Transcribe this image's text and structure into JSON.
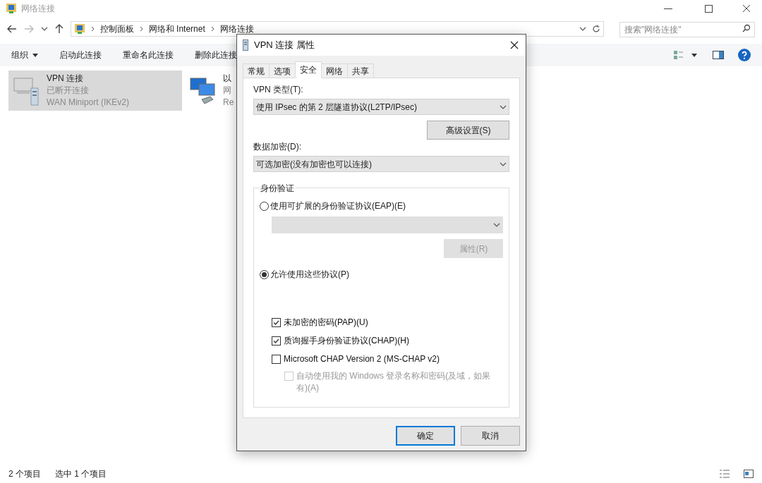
{
  "window": {
    "title": "网络连接"
  },
  "breadcrumbs": [
    "控制面板",
    "网络和 Internet",
    "网络连接"
  ],
  "search": {
    "placeholder": "搜索\"网络连接\""
  },
  "toolbar": [
    {
      "label": "组织",
      "kind": "menu"
    },
    {
      "label": "启动此连接",
      "kind": "action"
    },
    {
      "label": "重命名此连接",
      "kind": "action"
    },
    {
      "label": "删除此连接",
      "kind": "action"
    }
  ],
  "connections": [
    {
      "name": "VPN 连接",
      "status": "已断开连接",
      "device": "WAN Miniport (IKEv2)",
      "selected": true,
      "kind": "vpn"
    },
    {
      "name": "以",
      "status": "网",
      "device": "Re",
      "selected": false,
      "kind": "ethernet"
    }
  ],
  "status_bar": {
    "count": "2 个项目",
    "selection": "选中 1 个项目"
  },
  "dialog": {
    "title": "VPN 连接 属性",
    "tabs": [
      {
        "label": "常规",
        "selected": false
      },
      {
        "label": "选项",
        "selected": false
      },
      {
        "label": "安全",
        "selected": true
      },
      {
        "label": "网络",
        "selected": false
      },
      {
        "label": "共享",
        "selected": false
      }
    ],
    "vpn_type": {
      "label": "VPN 类型(T):",
      "value": "使用 IPsec 的第 2 层隧道协议(L2TP/IPsec)"
    },
    "advanced_button": "高级设置(S)",
    "encryption": {
      "label": "数据加密(D):",
      "value": "可选加密(没有加密也可以连接)"
    },
    "auth": {
      "title": "身份验证",
      "eap": {
        "label": "使用可扩展的身份验证协议(EAP)(E)",
        "selected": false
      },
      "eap_select": {
        "disabled": true
      },
      "properties_button": {
        "label": "属性(R)",
        "disabled": true
      },
      "protocols": {
        "label": "允许使用这些协议(P)",
        "selected": true
      },
      "options": [
        {
          "label": "未加密的密码(PAP)(U)",
          "checked": true,
          "disabled": false
        },
        {
          "label": "质询握手身份验证协议(CHAP)(H)",
          "checked": true,
          "disabled": false
        },
        {
          "label": "Microsoft CHAP Version 2 (MS-CHAP v2)",
          "checked": false,
          "disabled": false,
          "children": [
            {
              "label": "自动使用我的 Windows 登录名称和密码(及域，如果有)(A)",
              "checked": false,
              "disabled": true
            }
          ]
        }
      ]
    },
    "buttons": [
      "确定",
      "取消"
    ]
  }
}
